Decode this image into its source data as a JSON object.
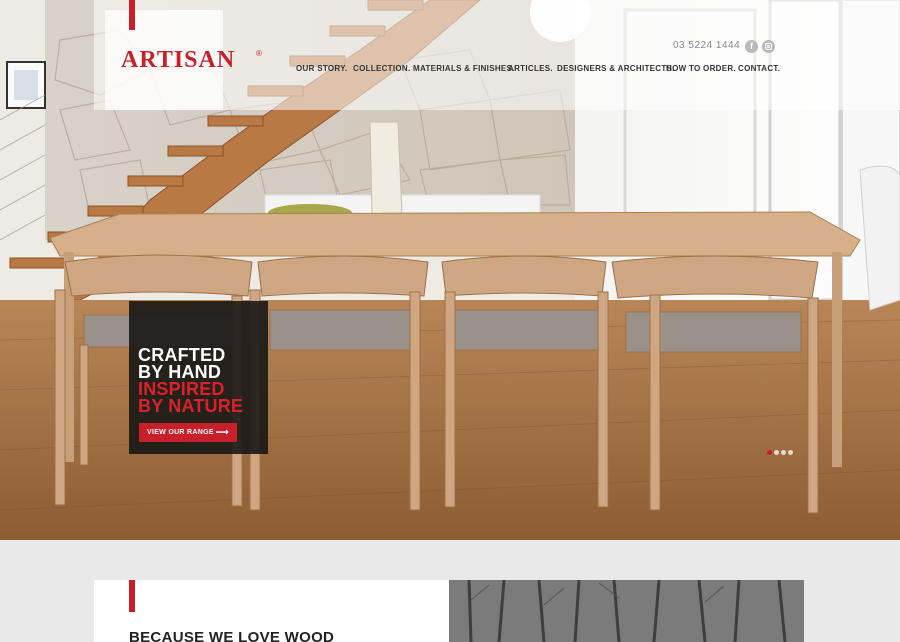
{
  "brand": {
    "name": "ARTISAN",
    "registered_mark": "®",
    "accent_color": "#c8202a"
  },
  "header": {
    "phone": "03 5224 1444",
    "social": [
      {
        "icon": "facebook-icon",
        "glyph": "f"
      },
      {
        "icon": "instagram-icon"
      }
    ],
    "nav": [
      {
        "label": "OUR STORY."
      },
      {
        "label": "COLLECTION."
      },
      {
        "label": "MATERIALS & FINISHES."
      },
      {
        "label": "ARTICLES."
      },
      {
        "label": "DESIGNERS & ARCHITECTS."
      },
      {
        "label": "HOW TO ORDER."
      },
      {
        "label": "CONTACT."
      }
    ]
  },
  "hero": {
    "lines": [
      "CRAFTED",
      "BY HAND",
      "INSPIRED",
      "BY NATURE"
    ],
    "cta_label": "VIEW OUR RANGE",
    "cta_arrow": "⟶",
    "slides_total": 4,
    "slide_active": 1
  },
  "section": {
    "title": "BECAUSE WE LOVE WOOD"
  }
}
